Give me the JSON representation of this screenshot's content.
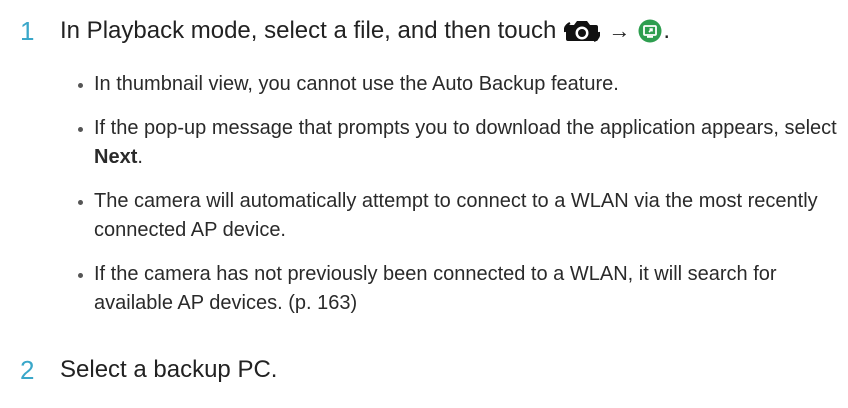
{
  "step1": {
    "number": "1",
    "text": "In Playback mode, select a file, and then touch",
    "arrow": "→",
    "period": ".",
    "icons": [
      "camera-share-icon",
      "auto-backup-icon"
    ],
    "accent_color": "#3aa7c9",
    "backup_icon_color": "#2e9e4f"
  },
  "bullets": [
    {
      "text": "In thumbnail view, you cannot use the Auto Backup feature."
    },
    {
      "text_before": "If the pop-up message that prompts you to download the application appears, select ",
      "bold": "Next",
      "text_after": "."
    },
    {
      "text": "The camera will automatically attempt to connect to a WLAN via the most recently connected AP device."
    },
    {
      "text": "If the camera has not previously been connected to a WLAN, it will search for available AP devices. (p. 163)"
    }
  ],
  "step2": {
    "number": "2",
    "text": "Select a backup PC."
  }
}
